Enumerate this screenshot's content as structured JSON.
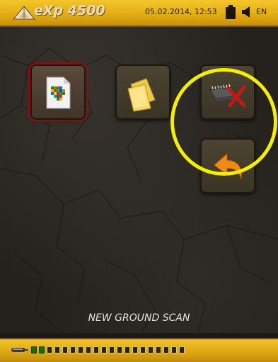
{
  "header": {
    "logo_text": "eXp 4500",
    "datetime": "05.02.2014, 12:53",
    "language": "EN",
    "battery_icon": "battery-icon",
    "sound_icon": "speaker-icon"
  },
  "menu": {
    "items": [
      {
        "name": "new-ground-scan",
        "icon": "ground-scan-file-icon",
        "selected": true
      },
      {
        "name": "open-files",
        "icon": "folder-icon",
        "selected": false
      },
      {
        "name": "delete-memory",
        "icon": "memory-chip-delete-icon",
        "selected": false
      },
      {
        "name": "back",
        "icon": "back-arrow-icon",
        "selected": false
      }
    ]
  },
  "status": {
    "text": "NEW GROUND SCAN"
  },
  "footer": {
    "probe_icon": "probe-icon",
    "signal_level": 0.1
  },
  "colors": {
    "bar_yellow": "#e3ae14",
    "highlight": "#f4ee00",
    "selected_border": "#7a1414",
    "back_arrow": "#f08a16"
  }
}
